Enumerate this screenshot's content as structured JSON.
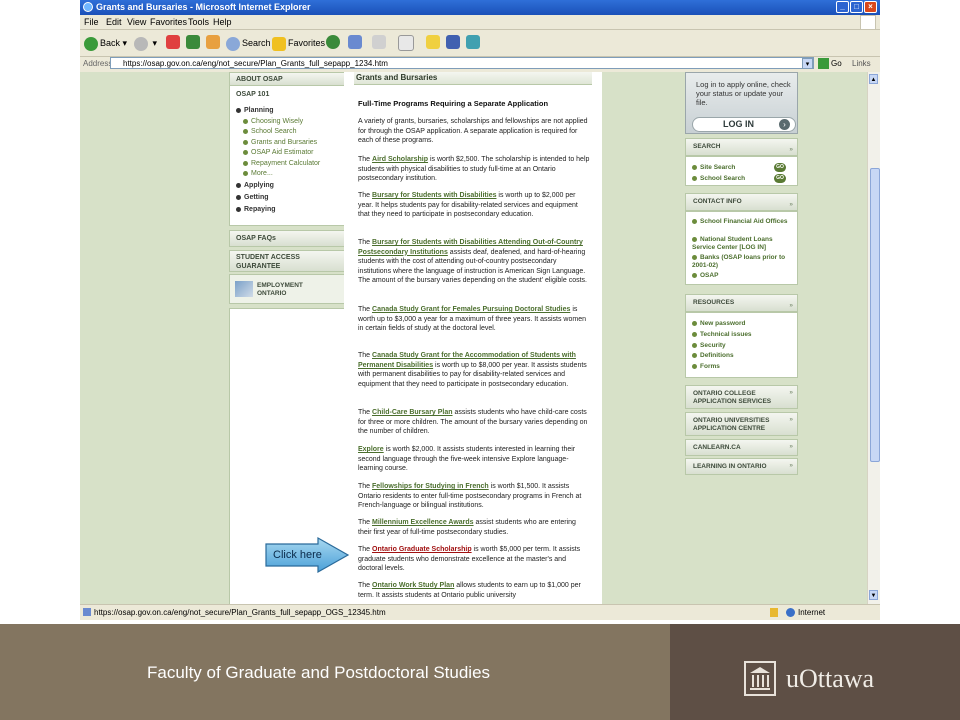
{
  "window": {
    "title": "Grants and Bursaries - Microsoft Internet Explorer",
    "controls": [
      "_",
      "□",
      "×"
    ]
  },
  "menubar": [
    "File",
    "Edit",
    "View",
    "Favorites",
    "Tools",
    "Help"
  ],
  "toolbar": {
    "back": "Back",
    "search": "Search",
    "favorites": "Favorites"
  },
  "addressbar": {
    "label": "Address",
    "url": "https://osap.gov.on.ca/eng/not_secure/Plan_Grants_full_sepapp_1234.htm",
    "go": "Go",
    "links": "Links"
  },
  "left_nav": {
    "about": "ABOUT OSAP",
    "osap101": "OSAP 101",
    "planning": "Planning",
    "planning_items": [
      "Choosing Wisely",
      "School Search",
      "Grants and Bursaries",
      "OSAP Aid Estimator",
      "Repayment Calculator",
      "More..."
    ],
    "applying": "Applying",
    "getting": "Getting",
    "repaying": "Repaying",
    "faqs": "OSAP FAQs",
    "student_access_1": "STUDENT ACCESS",
    "student_access_2": "GUARANTEE",
    "employment_1": "EMPLOYMENT",
    "employment_2": "ONTARIO"
  },
  "content": {
    "heading": "Grants and Bursaries",
    "subheading": "Full-Time Programs Requiring a Separate Application",
    "intro": "A variety of grants, bursaries, scholarships and fellowships are not applied for through the OSAP application. A separate application is required for each of these programs.",
    "p1_pre": "The ",
    "p1_link": "Aird Scholarship",
    "p1_post": " is worth $2,500. The scholarship is intended to help students with physical disabilities to study full-time at an Ontario postsecondary institution.",
    "p2_pre": "The ",
    "p2_link": "Bursary for Students with Disabilities",
    "p2_post": " is worth up to $2,000 per year. It helps students pay for disability-related services and equipment that they need to participate in postsecondary education.",
    "p3_pre": "The ",
    "p3_link": "Bursary for Students with Disabilities Attending Out-of-Country Postsecondary Institutions",
    "p3_post": " assists deaf, deafened, and hard-of-hearing students with the cost of attending out-of-country postsecondary institutions where the language of instruction is American Sign Language. The amount of the bursary varies depending on the student' eligible costs.",
    "p4_pre": "The ",
    "p4_link": "Canada Study Grant for Females Pursuing Doctoral Studies",
    "p4_post": " is worth up to $3,000 a year for a maximum of three years. It assists women in certain fields of study at the doctoral level.",
    "p5_pre": "The ",
    "p5_link": "Canada Study Grant for the Accommodation of Students with Permanent Disabilities",
    "p5_post": " is worth up to $8,000 per year. It assists students with permanent disabilities to pay for disability-related services and equipment that they need to participate in postsecondary education.",
    "p6_pre": "The ",
    "p6_link": "Child-Care Bursary Plan",
    "p6_post": " assists students who have child-care costs for three or more children. The amount of the bursary varies depending on the number of children.",
    "p7_link": "Explore",
    "p7_post": " is worth $2,000. It assists students interested in learning their second language through the five-week intensive Explore language-learning course.",
    "p8_pre": "The ",
    "p8_link": "Fellowships for Studying in French",
    "p8_post": " is worth $1,500. It assists Ontario residents to enter full-time postsecondary programs in French at French-language or bilingual institutions.",
    "p9_pre": "The ",
    "p9_link": "Millennium Excellence Awards",
    "p9_post": " assist students who are entering their first year of full-time postsecondary studies.",
    "p10_pre": "The ",
    "p10_link": "Ontario Graduate Scholarship",
    "p10_post": " is worth $5,000 per term. It assists graduate students who demonstrate excellence at the master's and doctoral levels.",
    "p11_pre": "The ",
    "p11_link": "Ontario Work Study Plan",
    "p11_post": " allows students to earn up to $1,000 per term. It assists students at Ontario public university"
  },
  "right_col": {
    "login_text": "Log in to apply online, check your status or update your file.",
    "login_button": "LOG IN",
    "search_head": "SEARCH",
    "site_search": "Site Search",
    "school_search": "School Search",
    "go_label": "GO",
    "contact_head": "CONTACT INFO",
    "contact_items": [
      "School Financial Aid Offices",
      "National Student Loans Service Center [LOG IN]",
      "Banks (OSAP loans prior to 2001-02)",
      "OSAP"
    ],
    "resources_head": "RESOURCES",
    "resources_items": [
      "New password",
      "Technical issues",
      "Security",
      "Definitions",
      "Forms"
    ],
    "links": [
      "ONTARIO COLLEGE APPLICATION SERVICES",
      "ONTARIO UNIVERSITIES APPLICATION CENTRE",
      "CANLEARN.CA",
      "LEARNING IN ONTARIO"
    ]
  },
  "callout": "Click here",
  "statusbar": {
    "url": "https://osap.gov.on.ca/eng/not_secure/Plan_Grants_full_sepapp_OGS_12345.htm",
    "zone": "Internet"
  },
  "footer": {
    "faculty": "Faculty of Graduate and Postdoctoral Studies",
    "brand": "uOttawa"
  }
}
